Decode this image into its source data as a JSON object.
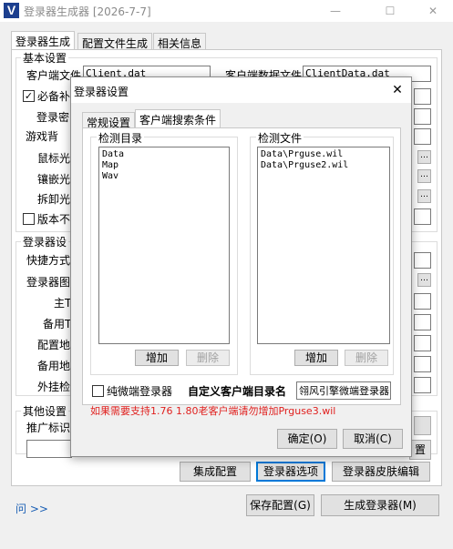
{
  "window": {
    "title": "登录器生成器 [2026-7-7]",
    "app_icon": "V",
    "min_glyph": "—",
    "max_glyph": "☐",
    "close_glyph": "✕"
  },
  "main_tabs": [
    "登录器生成",
    "配置文件生成",
    "相关信息"
  ],
  "basic": {
    "group": "基本设置",
    "client_file_label": "客户端文件",
    "client_file_value": "Client.dat",
    "client_data_label": "客户端数据文件",
    "client_data_value": "ClientData.dat",
    "patch_label": "必备补",
    "login_pwd_label": "登录密",
    "game_bg_label": "游戏背",
    "mouse_label": "鼠标光",
    "embed_label": "镶嵌光",
    "remove_label": "拆卸光",
    "version_label": "版本不"
  },
  "login_settings": {
    "group": "登录器设",
    "shortcut_label": "快捷方式",
    "icon_label": "登录器图",
    "main_label": "主T",
    "backup_label": "备用T",
    "config_label": "配置地",
    "backup_addr_label": "备用地",
    "plugin_label": "外挂检"
  },
  "other": {
    "group": "其他设置",
    "promo_label": "推广标识"
  },
  "bottom_buttons": {
    "integrate": "集成配置",
    "login_options": "登录器选项",
    "skin_edit": "登录器皮肤编辑",
    "save_config": "保存配置(G)",
    "generate": "生成登录器(M)",
    "partial": "置"
  },
  "help_link": "问 >>",
  "dialog": {
    "title": "登录器设置",
    "close_glyph": "✕",
    "tabs": [
      "常规设置",
      "客户端搜索条件"
    ],
    "check_dir_group": "检测目录",
    "check_dirs": [
      "Data",
      "Map",
      "Wav"
    ],
    "check_file_group": "检测文件",
    "check_files": [
      "Data\\Prguse.wil",
      "Data\\Prguse2.wil"
    ],
    "add_label": "增加",
    "delete_label": "删除",
    "pure_micro_label": "纯微端登录器",
    "custom_dir_label": "自定义客户端目录名",
    "custom_dir_value": "翎风引擎微端登录器",
    "warning": "如果需要支持1.76 1.80老客户端请勿增加Prguse3.wil",
    "ok": "确定(O)",
    "cancel": "取消(C)"
  }
}
